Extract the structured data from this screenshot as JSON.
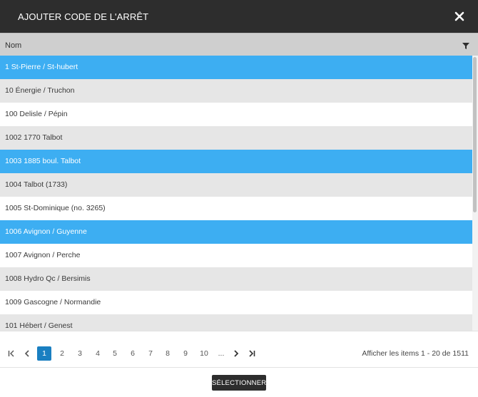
{
  "dialog": {
    "title": "AJOUTER CODE DE L'ARRÊT"
  },
  "grid": {
    "column_header": "Nom",
    "rows": [
      {
        "label": "1 St-Pierre / St-hubert",
        "selected": true
      },
      {
        "label": "10 Énergie / Truchon",
        "selected": false
      },
      {
        "label": "100 Delisle / Pépin",
        "selected": false
      },
      {
        "label": "1002 1770 Talbot",
        "selected": false
      },
      {
        "label": "1003 1885 boul. Talbot",
        "selected": true
      },
      {
        "label": "1004 Talbot (1733)",
        "selected": false
      },
      {
        "label": "1005 St-Dominique (no. 3265)",
        "selected": false
      },
      {
        "label": "1006 Avignon / Guyenne",
        "selected": true
      },
      {
        "label": "1007 Avignon / Perche",
        "selected": false
      },
      {
        "label": "1008 Hydro Qc / Bersimis",
        "selected": false
      },
      {
        "label": "1009 Gascogne / Normandie",
        "selected": false
      },
      {
        "label": "101 Hébert / Genest",
        "selected": false
      }
    ]
  },
  "pager": {
    "pages": [
      "1",
      "2",
      "3",
      "4",
      "5",
      "6",
      "7",
      "8",
      "9",
      "10"
    ],
    "current_page": "1",
    "ellipsis": "...",
    "info": "Afficher les items 1 - 20 de 1511"
  },
  "footer": {
    "select_label": "SÉLECTIONNER"
  },
  "colors": {
    "titlebar": "#2d2d2d",
    "header": "#cfcfcf",
    "selected_row": "#3daef2",
    "alt_row": "#e6e6e6",
    "active_page": "#1a7fc1"
  },
  "icons": {
    "close": "close-icon",
    "filter": "filter-icon",
    "first": "first-page-icon",
    "prev": "previous-page-icon",
    "next": "next-page-icon",
    "last": "last-page-icon"
  }
}
